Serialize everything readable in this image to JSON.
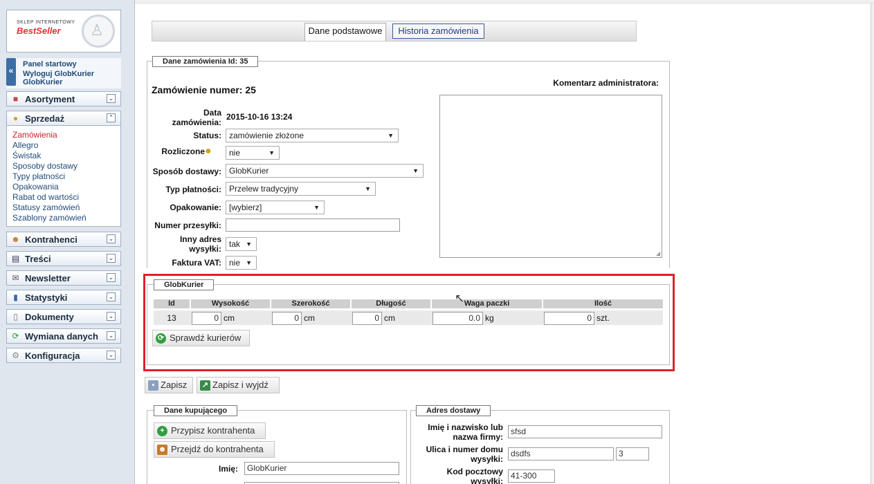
{
  "sidebar": {
    "logo_line1": "SKLEP INTERNETOWY",
    "logo_line2": "BestSeller",
    "collapse_glyph": "«",
    "links": [
      "Panel startowy",
      "Wyloguj GlobKurier",
      "GlobKurier"
    ],
    "menu": [
      {
        "label": "Asortyment",
        "icon": "boxes-icon",
        "expanded": false
      },
      {
        "label": "Sprzedaż",
        "icon": "coins-icon",
        "expanded": true
      },
      {
        "label": "Kontrahenci",
        "icon": "people-icon",
        "expanded": false
      },
      {
        "label": "Treści",
        "icon": "book-icon",
        "expanded": false
      },
      {
        "label": "Newsletter",
        "icon": "envelope-icon",
        "expanded": false
      },
      {
        "label": "Statystyki",
        "icon": "bar-chart-icon",
        "expanded": false
      },
      {
        "label": "Dokumenty",
        "icon": "document-icon",
        "expanded": false
      },
      {
        "label": "Wymiana danych",
        "icon": "sync-icon",
        "expanded": false
      },
      {
        "label": "Konfiguracja",
        "icon": "gear-icon",
        "expanded": false
      }
    ],
    "sales_items": [
      "Zamówienia",
      "Allegro",
      "Świstak",
      "Sposoby dostawy",
      "Typy płatności",
      "Opakowania",
      "Rabat od wartości",
      "Statusy zamówień",
      "Szablony zamówień"
    ],
    "active_sales_item": "Zamówienia",
    "chevron_down": "⌄",
    "chevron_up": "⌃"
  },
  "tabs": [
    "Dane podstawowe",
    "Historia zamówienia"
  ],
  "active_tab": "Dane podstawowe",
  "order": {
    "legend": "Dane zamówienia Id: 35",
    "title": "Zamówienie numer: 25",
    "comment_label": "Komentarz administratora:",
    "comment_value": "",
    "fields": {
      "date_label_1": "Data",
      "date_label_2": "zamówienia:",
      "date_value": "2015-10-16 13:24",
      "status_label": "Status:",
      "status_value": "zamówienie złożone",
      "settled_label": "Rozliczone",
      "settled_value": "nie",
      "delivery_label": "Sposób dostawy:",
      "delivery_value": "GlobKurier",
      "payment_label": "Typ płatności:",
      "payment_value": "Przelew tradycyjny",
      "packaging_label": "Opakowanie:",
      "packaging_value": "[wybierz]",
      "tracking_label": "Numer przesyłki:",
      "tracking_value": "",
      "other_addr_label_1": "Inny adres",
      "other_addr_label_2": "wysyłki:",
      "other_addr_value": "tak",
      "vat_label": "Faktura VAT:",
      "vat_value": "nie"
    }
  },
  "globkurier": {
    "legend": "GlobKurier",
    "headers": [
      "Id",
      "Wysokość",
      "Szerokość",
      "Długość",
      "Waga paczki",
      "Ilość"
    ],
    "row": {
      "id": "13",
      "height": "0",
      "height_unit": "cm",
      "width": "0",
      "width_unit": "cm",
      "length": "0",
      "length_unit": "cm",
      "weight": "0.0",
      "weight_unit": "kg",
      "qty": "0",
      "qty_unit": "szt."
    },
    "check_button": "Sprawdź kurierów"
  },
  "actions": {
    "save": "Zapisz",
    "save_exit": "Zapisz i wyjdź"
  },
  "buyer": {
    "legend": "Dane kupującego",
    "assign_button": "Przypisz kontrahenta",
    "goto_button": "Przejdź do kontrahenta",
    "name_label": "Imię:",
    "name_value": "GlobKurier"
  },
  "delivery_address": {
    "legend": "Adres dostawy",
    "fullname_label_1": "Imię i nazwisko lub",
    "fullname_label_2": "nazwa firmy:",
    "fullname_value": "sfsd",
    "street_label_1": "Ulica i numer domu",
    "street_label_2": "wysyłki:",
    "street_value": "dsdfs",
    "house_no": "3",
    "postal_label_1": "Kod pocztowy",
    "postal_label_2": "wysyłki:",
    "postal_value": "41-300"
  },
  "colors": {
    "highlight": "#e0202a",
    "link": "#1f4a7a",
    "active": "#d0202b"
  }
}
